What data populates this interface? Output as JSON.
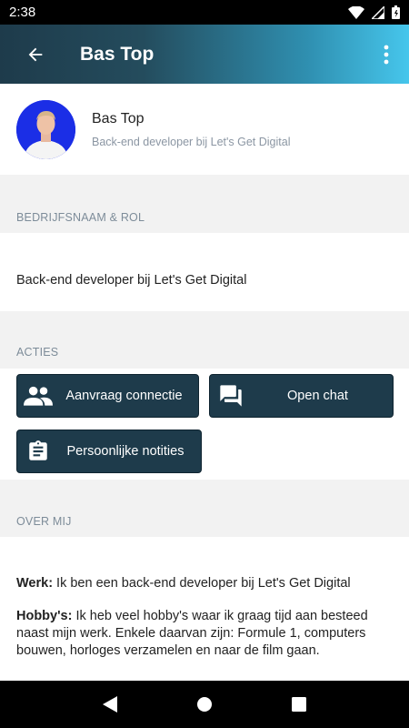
{
  "status_bar": {
    "time": "2:38"
  },
  "app_bar": {
    "title": "Bas Top"
  },
  "profile": {
    "name": "Bas Top",
    "subtitle": "Back-end developer bij Let's Get Digital",
    "avatar_bg": "#1b2ee6"
  },
  "sections": {
    "company_role": {
      "header": "BEDRIJFSNAAM & ROL",
      "value": "Back-end developer bij Let's Get Digital"
    },
    "actions": {
      "header": "ACTIES",
      "buttons": [
        {
          "label": "Aanvraag connectie",
          "icon": "people-icon"
        },
        {
          "label": "Open chat",
          "icon": "chat-icon"
        },
        {
          "label": "Persoonlijke notities",
          "icon": "clipboard-icon"
        }
      ]
    },
    "about": {
      "header": "OVER MIJ",
      "werk_label": "Werk:",
      "werk_text": " Ik ben een back-end developer bij Let's Get Digital",
      "hobbys_label": "Hobby's:",
      "hobbys_text": " Ik heb veel hobby's waar ik graag tijd aan besteed naast mijn werk. Enkele daarvan zijn: Formule 1, computers bouwen, horloges verzamelen en naar de film gaan."
    }
  },
  "colors": {
    "primary_dark": "#1e3b4b",
    "gradient_end": "#46c6ec",
    "section_text": "#7d8c99"
  }
}
